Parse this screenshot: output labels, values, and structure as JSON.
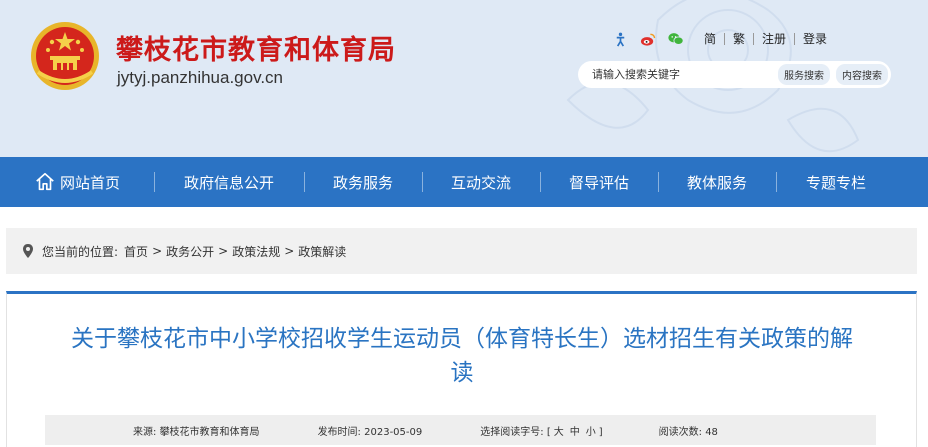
{
  "header": {
    "title": "攀枝花市教育和体育局",
    "domain": "jytyj.panzhihua.gov.cn",
    "links": [
      "简",
      "繁",
      "注册",
      "登录"
    ],
    "icons": [
      "accessibility-icon",
      "weibo-icon",
      "wechat-icon"
    ]
  },
  "search": {
    "placeholder": "请输入搜索关键字",
    "btn_site": "服务搜索",
    "btn_internal": "内容搜索"
  },
  "nav": {
    "items": [
      "网站首页",
      "政府信息公开",
      "政务服务",
      "互动交流",
      "督导评估",
      "教体服务",
      "专题专栏"
    ]
  },
  "breadcrumb": {
    "prefix": "您当前的位置:",
    "items": [
      "首页",
      "政务公开",
      "政策法规",
      "政策解读"
    ],
    "separator": ">"
  },
  "article": {
    "title_line1": "关于攀枝花市中小学校招收学生运动员（体育特长生）选材招生有关政策的解",
    "title_line2": "读",
    "meta": {
      "source_label": "来源:",
      "source": "攀枝花市教育和体育局",
      "date_label": "发布时间:",
      "date": "2023-05-09",
      "font_label": "选择阅读字号:",
      "font_open": "[",
      "font_sizes": [
        "大",
        "中",
        "小"
      ],
      "font_close": "]",
      "views_label": "阅读次数:",
      "views": "48"
    }
  },
  "colors": {
    "nav_bg": "#2b73c4",
    "title_red": "#cc1a1a",
    "article_title": "#2a74c2",
    "header_bg": "#dfe9f5"
  }
}
